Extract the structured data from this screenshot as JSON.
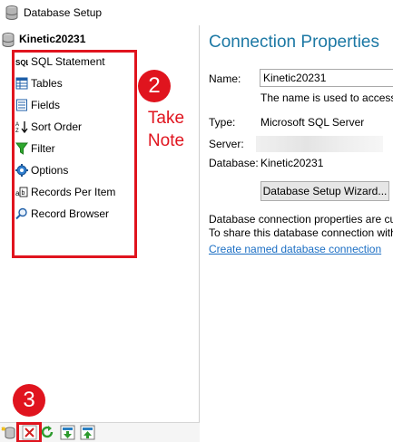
{
  "window": {
    "title": "Database Setup"
  },
  "tree": {
    "root_label": "Kinetic20231",
    "items": [
      {
        "label": "SQL Statement",
        "icon": "sql-icon"
      },
      {
        "label": "Tables",
        "icon": "table-icon"
      },
      {
        "label": "Fields",
        "icon": "fields-icon"
      },
      {
        "label": "Sort Order",
        "icon": "sort-icon"
      },
      {
        "label": "Filter",
        "icon": "filter-icon"
      },
      {
        "label": "Options",
        "icon": "gear-icon"
      },
      {
        "label": "Records Per Item",
        "icon": "records-per-item-icon"
      },
      {
        "label": "Record Browser",
        "icon": "magnifier-icon"
      }
    ]
  },
  "annotations": {
    "callout_2_number": "2",
    "callout_2_note": "Take Note",
    "callout_3_number": "3",
    "accent_color": "#e0141e"
  },
  "toolbar": {
    "buttons": [
      "add-database-icon",
      "delete-icon",
      "refresh-icon",
      "move-down-icon",
      "move-up-icon"
    ]
  },
  "properties": {
    "heading": "Connection Properties",
    "name_label": "Name:",
    "name_value": "Kinetic20231",
    "name_hint": "The name is used to access",
    "type_label": "Type:",
    "type_value": "Microsoft SQL Server",
    "server_label": "Server:",
    "database_label": "Database:",
    "database_value": "Kinetic20231",
    "wizard_button": "Database Setup Wizard...",
    "info_line1": "Database connection properties are cu",
    "info_line2": "To share this database connection with",
    "named_connection_link": "Create named database connection",
    "heading_color": "#1c78a4",
    "link_color": "#1c6fc4"
  }
}
